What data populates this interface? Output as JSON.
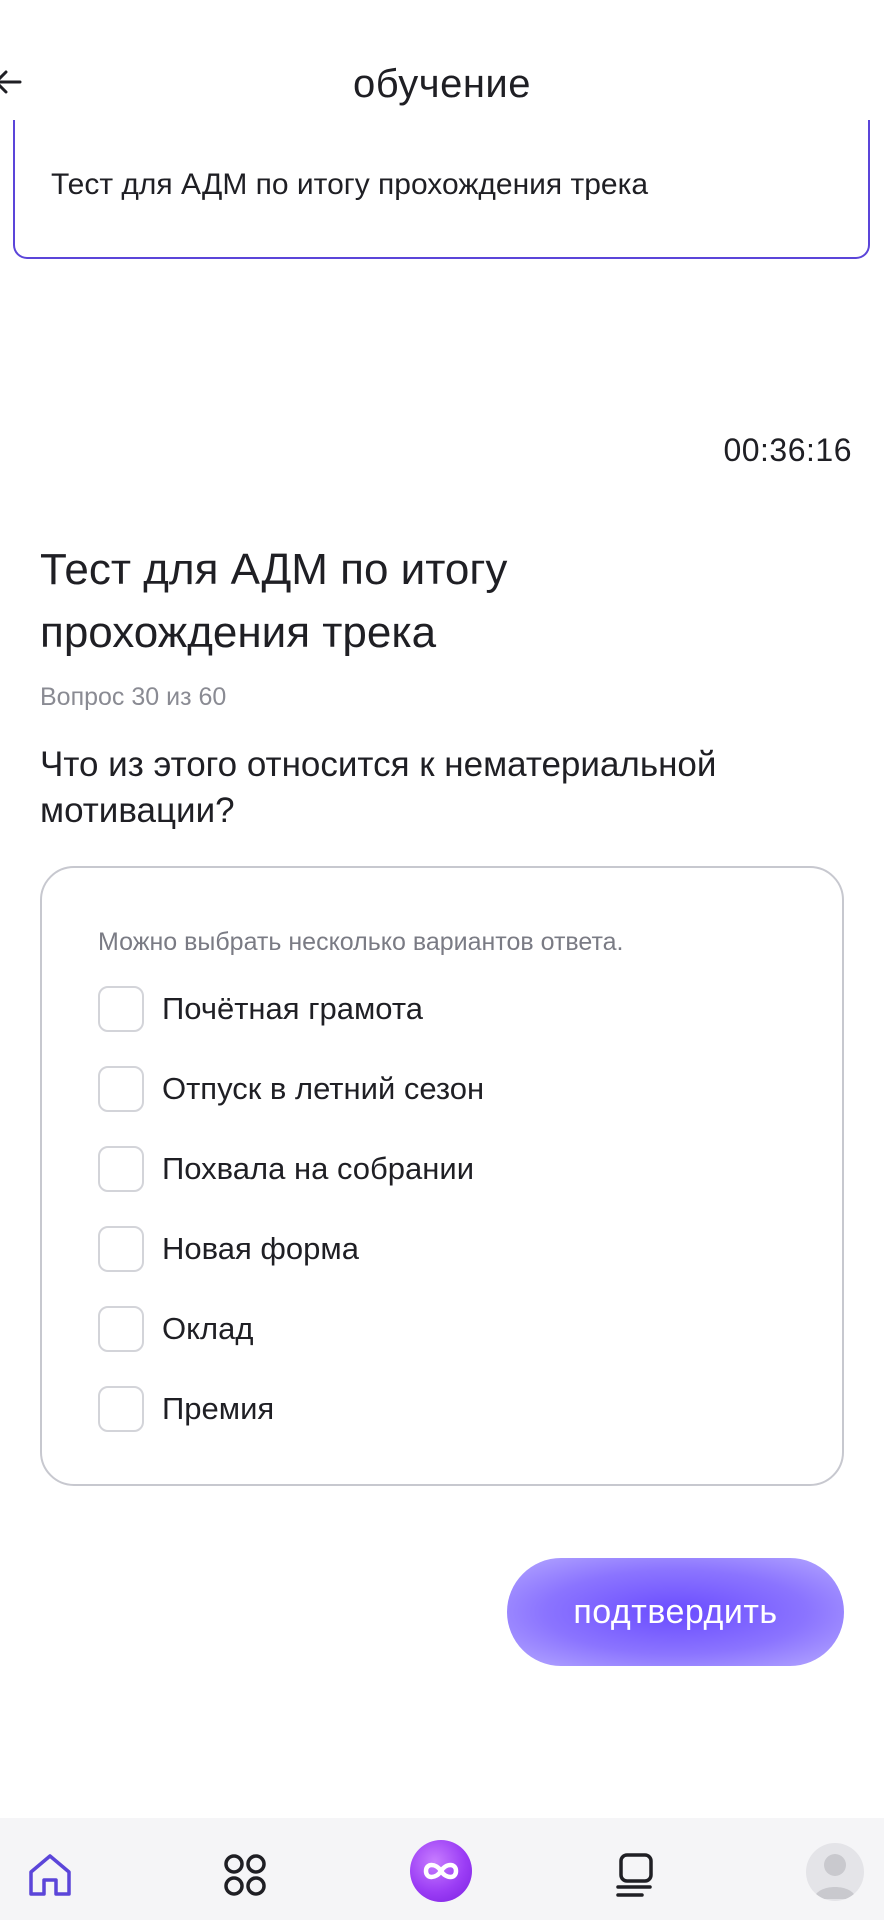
{
  "header": {
    "title": "обучение",
    "back_icon": "arrow-left-icon"
  },
  "banner": {
    "text": "Тест для АДМ по итогу прохождения трека"
  },
  "timer": "00:36:16",
  "test": {
    "title": "Тест для АДМ по итогу прохождения трека",
    "counter": "Вопрос 30 из 60",
    "question": "Что из этого относится к нематериальной мотивации?"
  },
  "answers": {
    "hint": "Можно выбрать несколько вариантов ответа.",
    "options": [
      {
        "label": "Почётная грамота",
        "checked": false
      },
      {
        "label": "Отпуск в летний сезон",
        "checked": false
      },
      {
        "label": "Похвала на собрании",
        "checked": false
      },
      {
        "label": "Новая форма",
        "checked": false
      },
      {
        "label": "Оклад",
        "checked": false
      },
      {
        "label": "Премия",
        "checked": false
      }
    ]
  },
  "confirm_button": "подтвердить",
  "colors": {
    "accent": "#6a4cff",
    "banner_border": "#5b45d9",
    "muted_text": "#8a8b93",
    "nav_background": "#f5f5f7"
  },
  "bottom_nav": {
    "items": [
      {
        "icon": "home-icon",
        "active": true
      },
      {
        "icon": "grid-icon",
        "active": false
      },
      {
        "icon": "infinity-icon",
        "active": false
      },
      {
        "icon": "document-list-icon",
        "active": false
      },
      {
        "icon": "avatar-icon",
        "active": false
      }
    ]
  }
}
